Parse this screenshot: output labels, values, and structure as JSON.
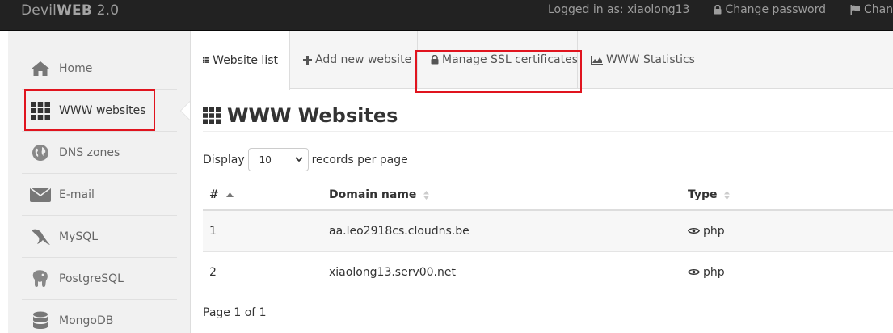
{
  "app": {
    "brand_prefix": "Devil",
    "brand_bold": "WEB",
    "brand_suffix": " 2.0"
  },
  "topnav": {
    "logged_in": "Logged in as: xiaolong13",
    "change_password": "Change password",
    "change_language": "Change la"
  },
  "sidebar": {
    "items": [
      {
        "label": "Home",
        "icon": "home-icon"
      },
      {
        "label": "WWW websites",
        "icon": "grid-icon"
      },
      {
        "label": "DNS zones",
        "icon": "globe-icon"
      },
      {
        "label": "E-mail",
        "icon": "envelope-icon"
      },
      {
        "label": "MySQL",
        "icon": "dolphin-icon"
      },
      {
        "label": "PostgreSQL",
        "icon": "elephant-icon"
      },
      {
        "label": "MongoDB",
        "icon": "database-icon"
      }
    ]
  },
  "tabs": [
    {
      "label": "Website list",
      "icon": "list-icon"
    },
    {
      "label": "Add new website",
      "icon": "plus-icon"
    },
    {
      "label": "Manage SSL certificates",
      "icon": "lock-icon"
    },
    {
      "label": "WWW Statistics",
      "icon": "area-chart-icon"
    }
  ],
  "main": {
    "title": "WWW Websites",
    "display_label": "Display",
    "records_label": "records per page",
    "page_size": "10",
    "columns": [
      "#",
      "Domain name",
      "Type"
    ],
    "rows": [
      {
        "num": "1",
        "domain": "aa.leo2918cs.cloudns.be",
        "type": "php"
      },
      {
        "num": "2",
        "domain": "xiaolong13.serv00.net",
        "type": "php"
      }
    ],
    "pager": "Page 1 of 1"
  },
  "colors": {
    "highlight": "#e0141e",
    "topbar": "#222222",
    "sidebar": "#f1f1f1"
  }
}
